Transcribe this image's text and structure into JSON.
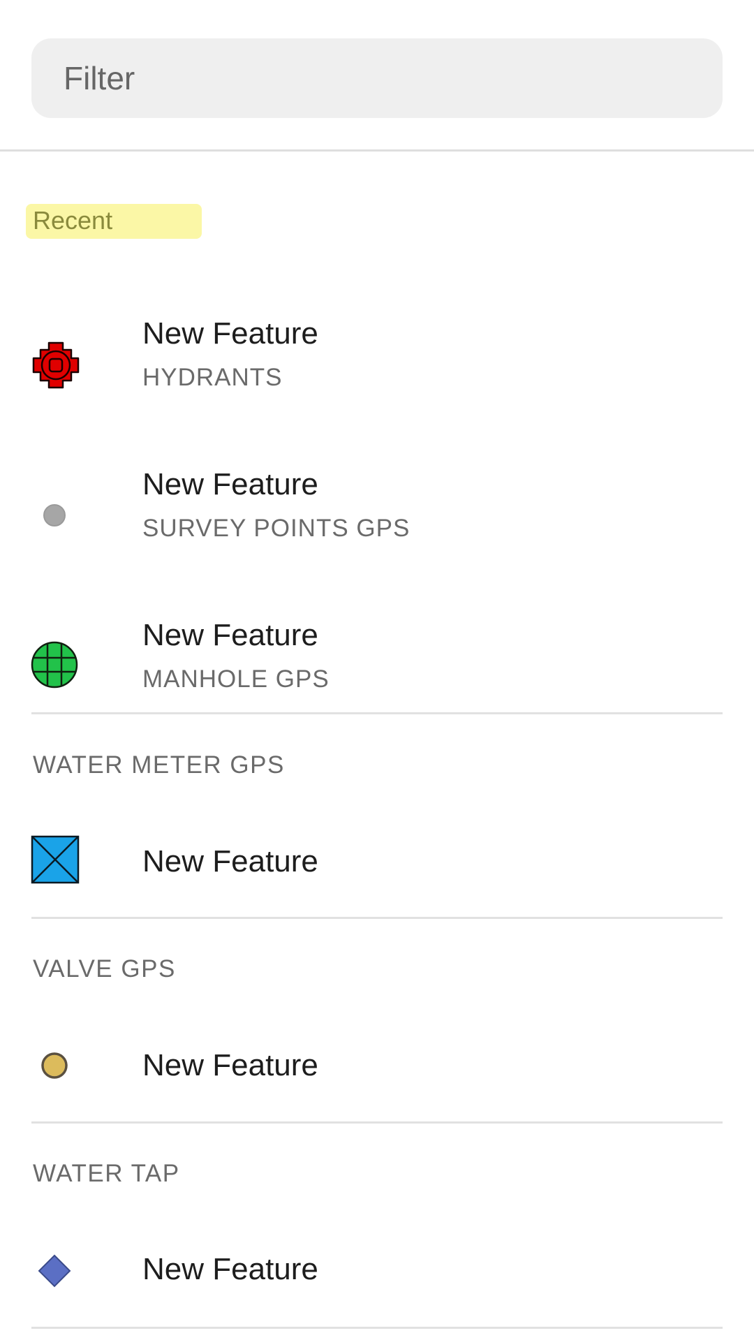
{
  "filter": {
    "placeholder": "Filter",
    "value": ""
  },
  "recent": {
    "label": "Recent",
    "highlight_color": "#fbf7a6",
    "items": [
      {
        "title": "New Feature",
        "subtitle": "HYDRANTS",
        "icon": "hydrant-icon"
      },
      {
        "title": "New Feature",
        "subtitle": "SURVEY POINTS GPS",
        "icon": "survey-point-icon"
      },
      {
        "title": "New Feature",
        "subtitle": "MANHOLE GPS",
        "icon": "manhole-icon"
      }
    ]
  },
  "sections": [
    {
      "header": "WATER METER GPS",
      "items": [
        {
          "title": "New Feature",
          "icon": "water-meter-icon"
        }
      ]
    },
    {
      "header": "VALVE GPS",
      "items": [
        {
          "title": "New Feature",
          "icon": "valve-icon"
        }
      ]
    },
    {
      "header": "WATER TAP",
      "items": [
        {
          "title": "New Feature",
          "icon": "water-tap-icon"
        }
      ]
    }
  ],
  "colors": {
    "hydrant": "#e00000",
    "survey_point": "#a6a6a6",
    "manhole": "#22c24a",
    "water_meter": "#1aa3e8",
    "valve": "#dcbb5c",
    "water_tap": "#5b6fc4"
  }
}
